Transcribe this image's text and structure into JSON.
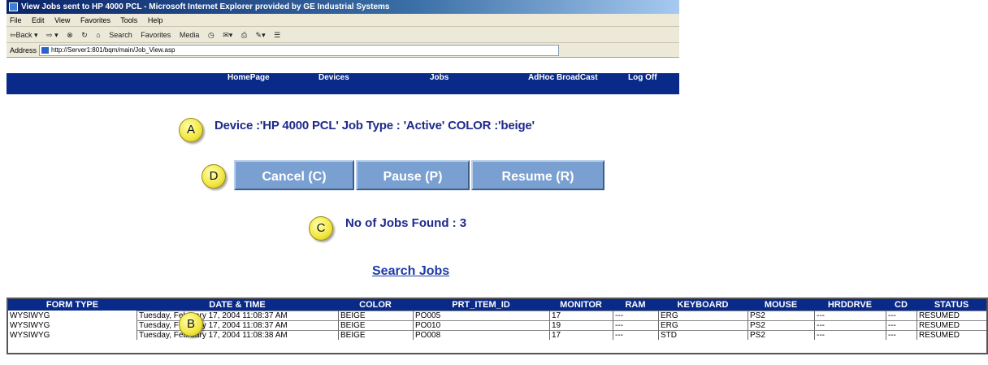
{
  "window": {
    "title": "View Jobs sent to HP 4000 PCL - Microsoft Internet Explorer provided by GE Industrial Systems",
    "menu": [
      "File",
      "Edit",
      "View",
      "Favorites",
      "Tools",
      "Help"
    ],
    "toolbar": [
      "⇦Back ▾",
      "⇨ ▾",
      "⊗",
      "↻",
      "⌂",
      "Search",
      "Favorites",
      "Media",
      "◷",
      "✉▾",
      "⎙",
      "✎▾",
      "☰"
    ],
    "address_label": "Address",
    "address_value": "http://Server1:801/bqm/main/Job_View.asp"
  },
  "nav": [
    "HomePage",
    "Devices",
    "Jobs",
    "AdHoc BroadCast",
    "Log Off"
  ],
  "device_line": "Device :'HP 4000 PCL'   Job Type : 'Active'   COLOR :'beige'",
  "buttons": {
    "cancel": "Cancel  (C)",
    "pause": "Pause (P)",
    "resume": "Resume (R)"
  },
  "jobs_found": "No of Jobs Found : 3",
  "search_link": "Search Jobs",
  "callouts": {
    "a": "A",
    "b": "B",
    "c": "C",
    "d": "D"
  },
  "table": {
    "headers": [
      "FORM TYPE",
      "DATE & TIME",
      "COLOR",
      "PRT_ITEM_ID",
      "MONITOR",
      "RAM",
      "KEYBOARD",
      "MOUSE",
      "HRDDRVE",
      "CD",
      "STATUS"
    ],
    "rows": [
      [
        "WYSIWYG",
        "Tuesday, February 17, 2004 11:08:37 AM",
        "BEIGE",
        "PO005",
        "17",
        "---",
        "ERG",
        "PS2",
        "---",
        "---",
        "RESUMED"
      ],
      [
        "WYSIWYG",
        "Tuesday, February 17, 2004 11:08:37 AM",
        "BEIGE",
        "PO010",
        "19",
        "---",
        "ERG",
        "PS2",
        "---",
        "---",
        "RESUMED"
      ],
      [
        "WYSIWYG",
        "Tuesday, February 17, 2004 11:08:38 AM",
        "BEIGE",
        "PO008",
        "17",
        "---",
        "STD",
        "PS2",
        "---",
        "---",
        "RESUMED"
      ]
    ]
  }
}
